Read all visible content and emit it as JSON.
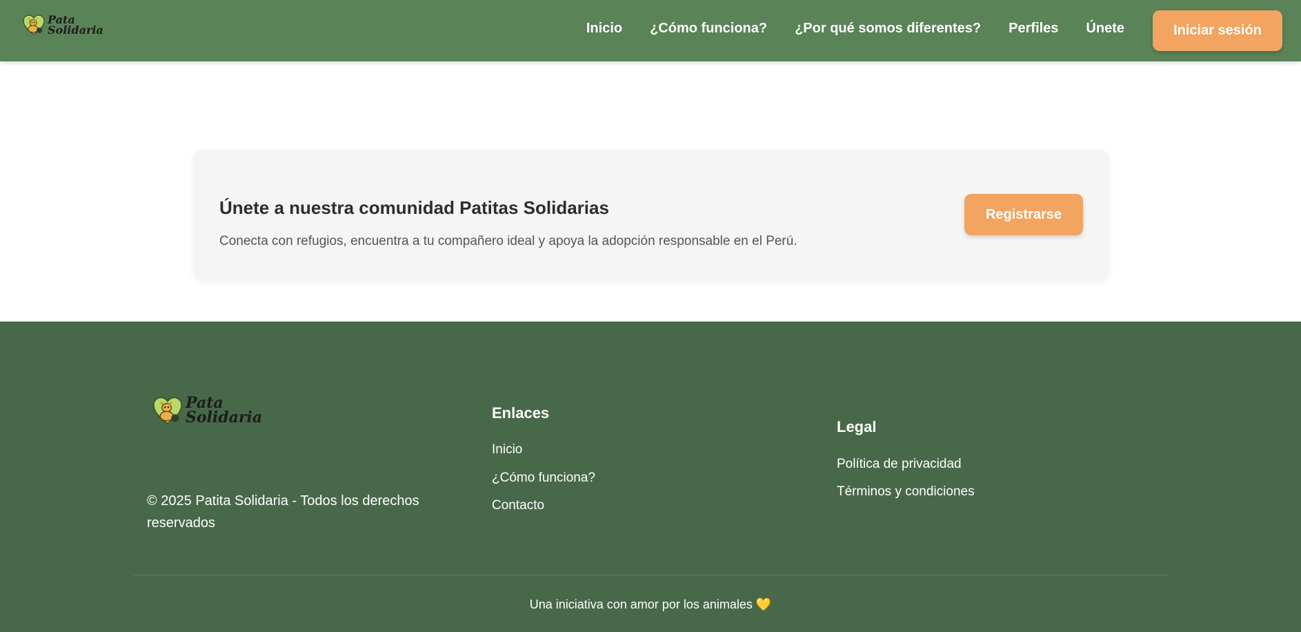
{
  "header": {
    "logo": {
      "line1": "Pata",
      "line2": "Solidaria",
      "icon": "dog-heart-logo-icon"
    },
    "nav": [
      "Inicio",
      "¿Cómo funciona?",
      "¿Por qué somos diferentes?",
      "Perfiles",
      "Únete"
    ],
    "login_label": "Iniciar sesión"
  },
  "cta": {
    "title": "Únete a nuestra comunidad Patitas Solidarias",
    "description": "Conecta con refugios, encuentra a tu compañero ideal y apoya la adopción responsable en el Perú.",
    "button_label": "Registrarse"
  },
  "footer": {
    "logo": {
      "line1": "Pata",
      "line2": "Solidaria"
    },
    "copyright": "© 2025 Patita Solidaria - Todos los derechos reservados",
    "links_title": "Enlaces",
    "links": [
      "Inicio",
      "¿Cómo funciona?",
      "Contacto"
    ],
    "legal_title": "Legal",
    "legal_links": [
      "Política de privacidad",
      "Términos y condiciones"
    ],
    "tagline": "Una iniciativa con amor por los animales 💛"
  },
  "colors": {
    "header_bg": "#5a8358",
    "footer_bg": "#48684a",
    "accent": "#f2a460",
    "card_bg": "#f5f5f5"
  }
}
